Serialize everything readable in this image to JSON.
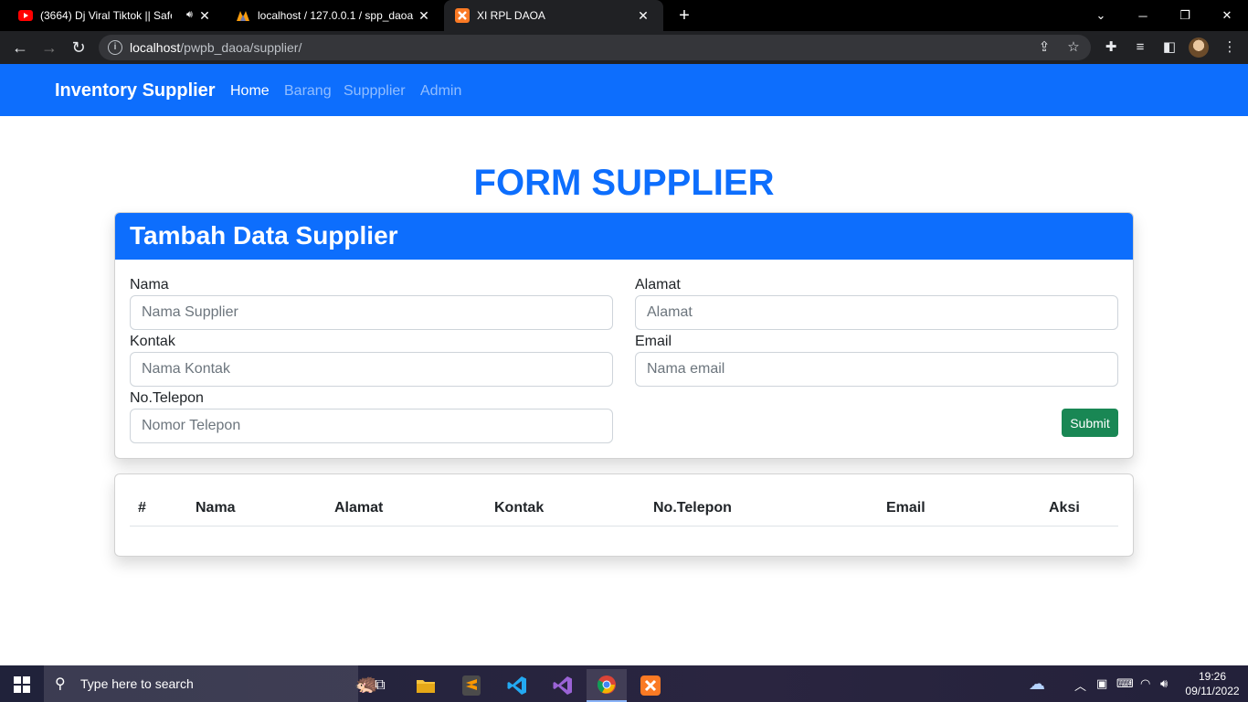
{
  "browser": {
    "tabs": [
      {
        "title": "(3664) Dj Viral Tiktok || Safe /",
        "icon": "youtube-icon"
      },
      {
        "title": "localhost / 127.0.0.1 / spp_daoa /",
        "icon": "phpmyadmin-icon"
      },
      {
        "title": "XI RPL DAOA",
        "icon": "xampp-icon",
        "active": true
      }
    ],
    "url_host": "localhost",
    "url_path": "/pwpb_daoa/supplier/"
  },
  "navbar": {
    "brand": "Inventory Supplier",
    "links": [
      "Home",
      "Barang",
      "Suppplier",
      "Admin"
    ]
  },
  "page": {
    "title": "FORM SUPPLIER"
  },
  "form": {
    "header": "Tambah Data Supplier",
    "fields": {
      "nama": {
        "label": "Nama",
        "placeholder": "Nama Supplier"
      },
      "alamat": {
        "label": "Alamat",
        "placeholder": "Alamat"
      },
      "kontak": {
        "label": "Kontak",
        "placeholder": "Nama Kontak"
      },
      "email": {
        "label": "Email",
        "placeholder": "Nama email"
      },
      "telepon": {
        "label": "No.Telepon",
        "placeholder": "Nomor Telepon"
      }
    },
    "submit_label": "Submit"
  },
  "table": {
    "columns": [
      "#",
      "Nama",
      "Alamat",
      "Kontak",
      "No.Telepon",
      "Email",
      "Aksi"
    ],
    "rows": []
  },
  "taskbar": {
    "search_placeholder": "Type here to search",
    "time": "19:26",
    "date": "09/11/2022"
  },
  "colors": {
    "primary": "#0d6efd",
    "success": "#198754"
  }
}
